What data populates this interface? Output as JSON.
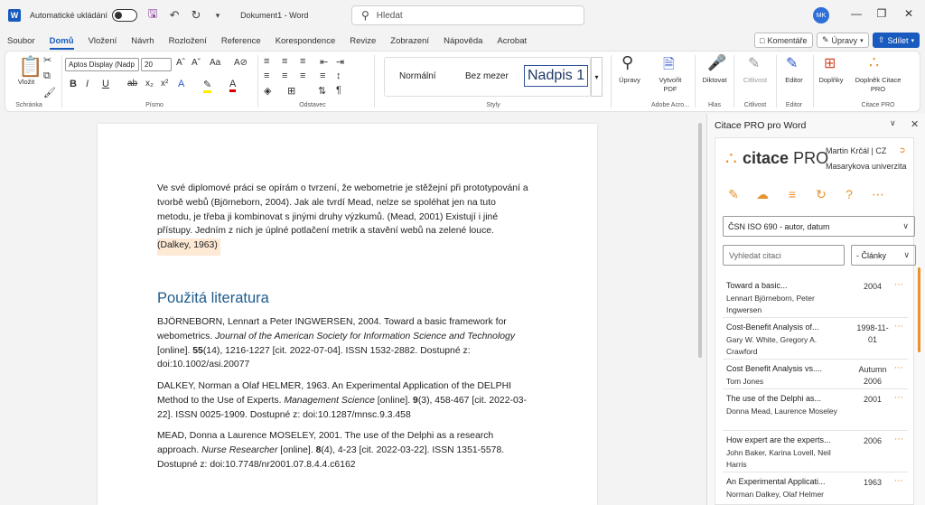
{
  "titlebar": {
    "autosave_label": "Automatické ukládání",
    "doc_title": "Dokument1 - Word",
    "search_placeholder": "Hledat",
    "avatar_initials": "MK"
  },
  "menu": {
    "tabs": [
      "Soubor",
      "Domů",
      "Vložení",
      "Návrh",
      "Rozložení",
      "Reference",
      "Korespondence",
      "Revize",
      "Zobrazení",
      "Nápověda",
      "Acrobat"
    ],
    "active": "Domů",
    "comments": "Komentáře",
    "edits": "Úpravy",
    "share": "Sdílet"
  },
  "ribbon": {
    "paste": "Vložit",
    "font_name": "Aptos Display (Nadp",
    "font_size": "20",
    "styles": [
      "Normální",
      "Bez mezer",
      "Nadpis 1"
    ],
    "edit": "Úpravy",
    "create_pdf": "Vytvořit PDF",
    "dictate": "Diktovat",
    "sensitivity": "Citlivost",
    "editor": "Editor",
    "addins": "Doplňky",
    "citace_addin": "Doplněk Citace PRO",
    "groups": [
      "Schránka",
      "Písmo",
      "Odstavec",
      "Styly",
      "Adobe Acro...",
      "Hlas",
      "Citlivost",
      "Editor",
      "Citace PRO"
    ]
  },
  "document": {
    "paragraph_lines": [
      "Ve své diplomové práci se opírám o tvrzení, že webometrie je stěžejní při prototypování a",
      "tvorbě webů (Björneborn, 2004). Jak ale tvrdí Mead, nelze se spoléhat jen na tuto",
      "metodu, je třeba ji kombinovat s jinými druhy výzkumů. (Mead, 2001) Existují i jiné",
      "přístupy. Jedním z nich je úplné potlačení metrik a stavění webů na zelené louce.",
      "(Dalkey, 1963)"
    ],
    "heading": "Použitá literatura",
    "refs": [
      {
        "l1a": "BJÖRNEBORN, Lennart a Peter INGWERSEN, 2004. Toward a basic framework for",
        "l2a": "webometrics. ",
        "l2b": "Journal of the American Society for Information Science and Technology",
        "l3a": "[online]. ",
        "l3b": "55",
        "l3c": "(14), 1216-1227 [cit. 2022-07-04]. ISSN 1532-2882. Dostupné z:",
        "l4a": "doi:10.1002/asi.20077"
      },
      {
        "l1a": "DALKEY, Norman a Olaf HELMER, 1963. An Experimental Application of the DELPHI",
        "l2a": "Method to the Use of Experts. ",
        "l2b": "Management Science",
        "l2c": " [online]. ",
        "l2d": "9",
        "l2e": "(3), 458-467 [cit. 2022-03-",
        "l3a": "22]. ISSN 0025-1909. Dostupné z: doi:10.1287/mnsc.9.3.458"
      },
      {
        "l1a": "MEAD, Donna a Laurence MOSELEY, 2001. The use of the Delphi as a research",
        "l2a": "approach. ",
        "l2b": "Nurse Researcher",
        "l2c": " [online]. ",
        "l2d": "8",
        "l2e": "(4), 4-23 [cit. 2022-03-22]. ISSN 1351-5578.",
        "l3a": "Dostupné z: doi:10.7748/nr2001.07.8.4.4.c6162"
      }
    ]
  },
  "panel": {
    "title": "Citace PRO pro Word",
    "logo_a": "citace",
    "logo_b": "PRO",
    "user_name": "Martin Krčál | CZ",
    "user_org": "Masarykova univerzita",
    "citation_style": "ČSN ISO 690 - autor, datum",
    "search_placeholder": "Vyhledat citaci",
    "type_filter": "- Články",
    "citations": [
      {
        "title": "Toward a basic...",
        "authors": "Lennart Björneborn, Peter Ingwersen",
        "year": "2004"
      },
      {
        "title": "Cost-Benefit Analysis of...",
        "authors": "Gary W. White, Gregory A. Crawford",
        "year": "1998-11-01"
      },
      {
        "title": "Cost Benefit Analysis vs....",
        "authors": "Tom Jones",
        "year": "Autumn 2006"
      },
      {
        "title": "The use of the Delphi as...",
        "authors": "Donna Mead, Laurence Moseley",
        "year": "2001"
      },
      {
        "title": "How expert are the experts...",
        "authors": "John Baker, Karina Lovell, Neil Harris",
        "year": "2006"
      },
      {
        "title": "An Experimental Applicati...",
        "authors": "Norman Dalkey, Olaf Helmer",
        "year": "1963"
      }
    ]
  }
}
